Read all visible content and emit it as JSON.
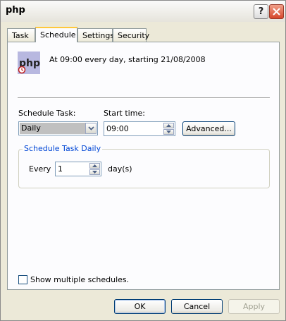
{
  "window": {
    "title": "php"
  },
  "tabs": [
    {
      "label": "Task"
    },
    {
      "label": "Schedule"
    },
    {
      "label": "Settings"
    },
    {
      "label": "Security"
    }
  ],
  "schedule": {
    "app_icon_text": "php",
    "summary": "At 09:00 every day, starting 21/08/2008",
    "schedule_task_label": "Schedule Task:",
    "schedule_task_value": "Daily",
    "start_time_label": "Start time:",
    "start_time_value": "09:00",
    "advanced_label": "Advanced...",
    "group_title": "Schedule Task Daily",
    "every_label": "Every",
    "every_value": "1",
    "days_label": "day(s)",
    "show_multiple_label": "Show multiple schedules."
  },
  "footer": {
    "ok_label": "OK",
    "cancel_label": "Cancel",
    "apply_label": "Apply"
  },
  "icons": {
    "help": "help-icon",
    "close": "close-icon",
    "dropdown": "chevron-down-icon",
    "spin_up": "arrow-up-icon",
    "spin_down": "arrow-down-icon"
  }
}
